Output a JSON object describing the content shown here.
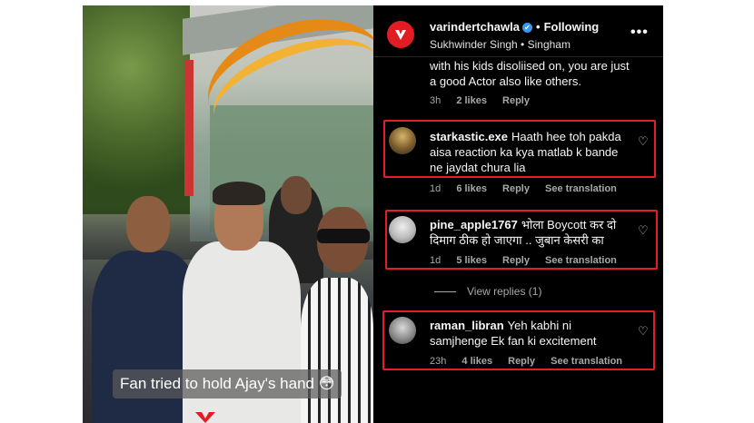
{
  "header": {
    "username": "varindertchawla",
    "verified_badge": "✔",
    "separator": "•",
    "following_label": "Following",
    "audio": "Sukhwinder Singh • Singham",
    "more_icon": "more-horizontal-icon",
    "more_label": "•••"
  },
  "video": {
    "caption": "Fan tried to hold Ajay's hand 😳"
  },
  "comments": [
    {
      "text": "with his kids disoliised on, you are just a good Actor also like others.",
      "time": "3h",
      "likes": "2 likes",
      "reply": "Reply"
    },
    {
      "username": "starkastic.exe",
      "text": "Haath hee toh pakda aisa reaction ka kya matlab k bande ne jaydat chura lia",
      "time": "1d",
      "likes": "6 likes",
      "reply": "Reply",
      "translate": "See translation",
      "heart_icon": "heart-outline-icon",
      "heart": "♡"
    },
    {
      "username": "pine_apple1767",
      "text": "भोला Boycott कर दो दिमाग ठीक हो जाएगा .. जुबान केसरी का",
      "time": "1d",
      "likes": "5 likes",
      "reply": "Reply",
      "translate": "See translation",
      "heart_icon": "heart-outline-icon",
      "heart": "♡"
    },
    {
      "username": "raman_libran",
      "text": "Yeh kabhi ni samjhenge Ek fan ki excitement",
      "time": "23h",
      "likes": "4 likes",
      "reply": "Reply",
      "translate": "See translation",
      "heart_icon": "heart-outline-icon",
      "heart": "♡"
    }
  ],
  "view_replies": "View replies (1)",
  "colors": {
    "background": "#000000",
    "highlight_box": "#e41e26",
    "verified": "#3897f0",
    "brand": "#e31b23",
    "meta_text": "#a8a8a8"
  }
}
